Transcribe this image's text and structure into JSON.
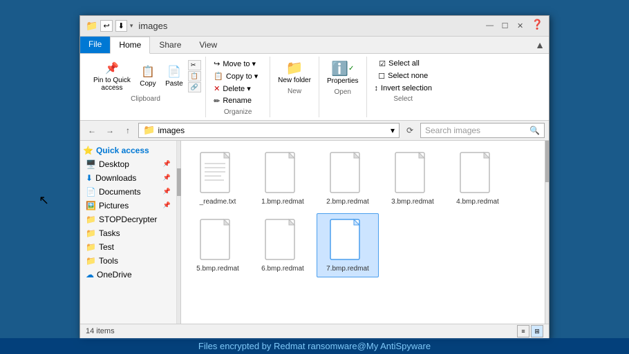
{
  "window": {
    "title": "images",
    "title_icon": "folder-icon"
  },
  "title_controls": {
    "minimize": "—",
    "maximize": "☐",
    "close": "✕"
  },
  "ribbon": {
    "tabs": [
      {
        "id": "file",
        "label": "File",
        "active": false
      },
      {
        "id": "home",
        "label": "Home",
        "active": true
      },
      {
        "id": "share",
        "label": "Share",
        "active": false
      },
      {
        "id": "view",
        "label": "View",
        "active": false
      }
    ],
    "groups": {
      "clipboard": {
        "label": "Clipboard",
        "buttons": [
          {
            "id": "pin-quick-access",
            "label": "Pin to Quick\naccess",
            "icon": "📌"
          },
          {
            "id": "copy",
            "label": "Copy",
            "icon": "📋"
          },
          {
            "id": "paste",
            "label": "Paste",
            "icon": "📄"
          }
        ]
      },
      "organize": {
        "label": "Organize",
        "items": [
          {
            "id": "move-to",
            "label": "Move to ▾"
          },
          {
            "id": "copy-to",
            "label": "Copy to ▾"
          },
          {
            "id": "delete",
            "label": "Delete ▾"
          },
          {
            "id": "rename",
            "label": "Rename"
          }
        ]
      },
      "new": {
        "label": "New",
        "new_folder": "New folder"
      },
      "open": {
        "label": "Open",
        "properties": "Properties"
      },
      "select": {
        "label": "Select",
        "select_all": "Select all",
        "select_none": "Select none",
        "invert_selection": "Invert selection"
      }
    }
  },
  "address_bar": {
    "back": "←",
    "forward": "→",
    "up": "↑",
    "path": "images",
    "refresh": "⟳",
    "search_placeholder": "Search images"
  },
  "sidebar": {
    "items": [
      {
        "id": "quick-access",
        "label": "Quick access",
        "icon": "⭐",
        "type": "header"
      },
      {
        "id": "desktop",
        "label": "Desktop",
        "icon": "🖥️",
        "pinned": true
      },
      {
        "id": "downloads",
        "label": "Downloads",
        "icon": "⬇️",
        "pinned": true
      },
      {
        "id": "documents",
        "label": "Documents",
        "icon": "📄",
        "pinned": true
      },
      {
        "id": "pictures",
        "label": "Pictures",
        "icon": "🖼️",
        "pinned": true
      },
      {
        "id": "stopdecrypter",
        "label": "STOPDecrypter",
        "icon": "📁"
      },
      {
        "id": "tasks",
        "label": "Tasks",
        "icon": "📁"
      },
      {
        "id": "test",
        "label": "Test",
        "icon": "📁"
      },
      {
        "id": "tools",
        "label": "Tools",
        "icon": "📁"
      },
      {
        "id": "onedrive",
        "label": "OneDrive",
        "icon": "☁️"
      }
    ]
  },
  "files": [
    {
      "id": "readme",
      "name": "_readme.txt",
      "type": "txt",
      "selected": false
    },
    {
      "id": "bmp1",
      "name": "1.bmp.redmat",
      "type": "redmat",
      "selected": false
    },
    {
      "id": "bmp2",
      "name": "2.bmp.redmat",
      "type": "redmat",
      "selected": false
    },
    {
      "id": "bmp3",
      "name": "3.bmp.redmat",
      "type": "redmat",
      "selected": false
    },
    {
      "id": "bmp4",
      "name": "4.bmp.redmat",
      "type": "redmat",
      "selected": false
    },
    {
      "id": "bmp5",
      "name": "5.bmp.redmat",
      "type": "redmat",
      "selected": false
    },
    {
      "id": "bmp6",
      "name": "6.bmp.redmat",
      "type": "redmat",
      "selected": false
    },
    {
      "id": "bmp7",
      "name": "7.bmp.redmat",
      "type": "redmat",
      "selected": true
    }
  ],
  "status": {
    "count": "14 items"
  },
  "watermark": {
    "text": "Files encrypted by Redmat ransomware@My AntiSpyware"
  },
  "colors": {
    "accent": "#0078d4",
    "file_tab": "#0078d4",
    "watermark_text": "#7ec8f8"
  }
}
